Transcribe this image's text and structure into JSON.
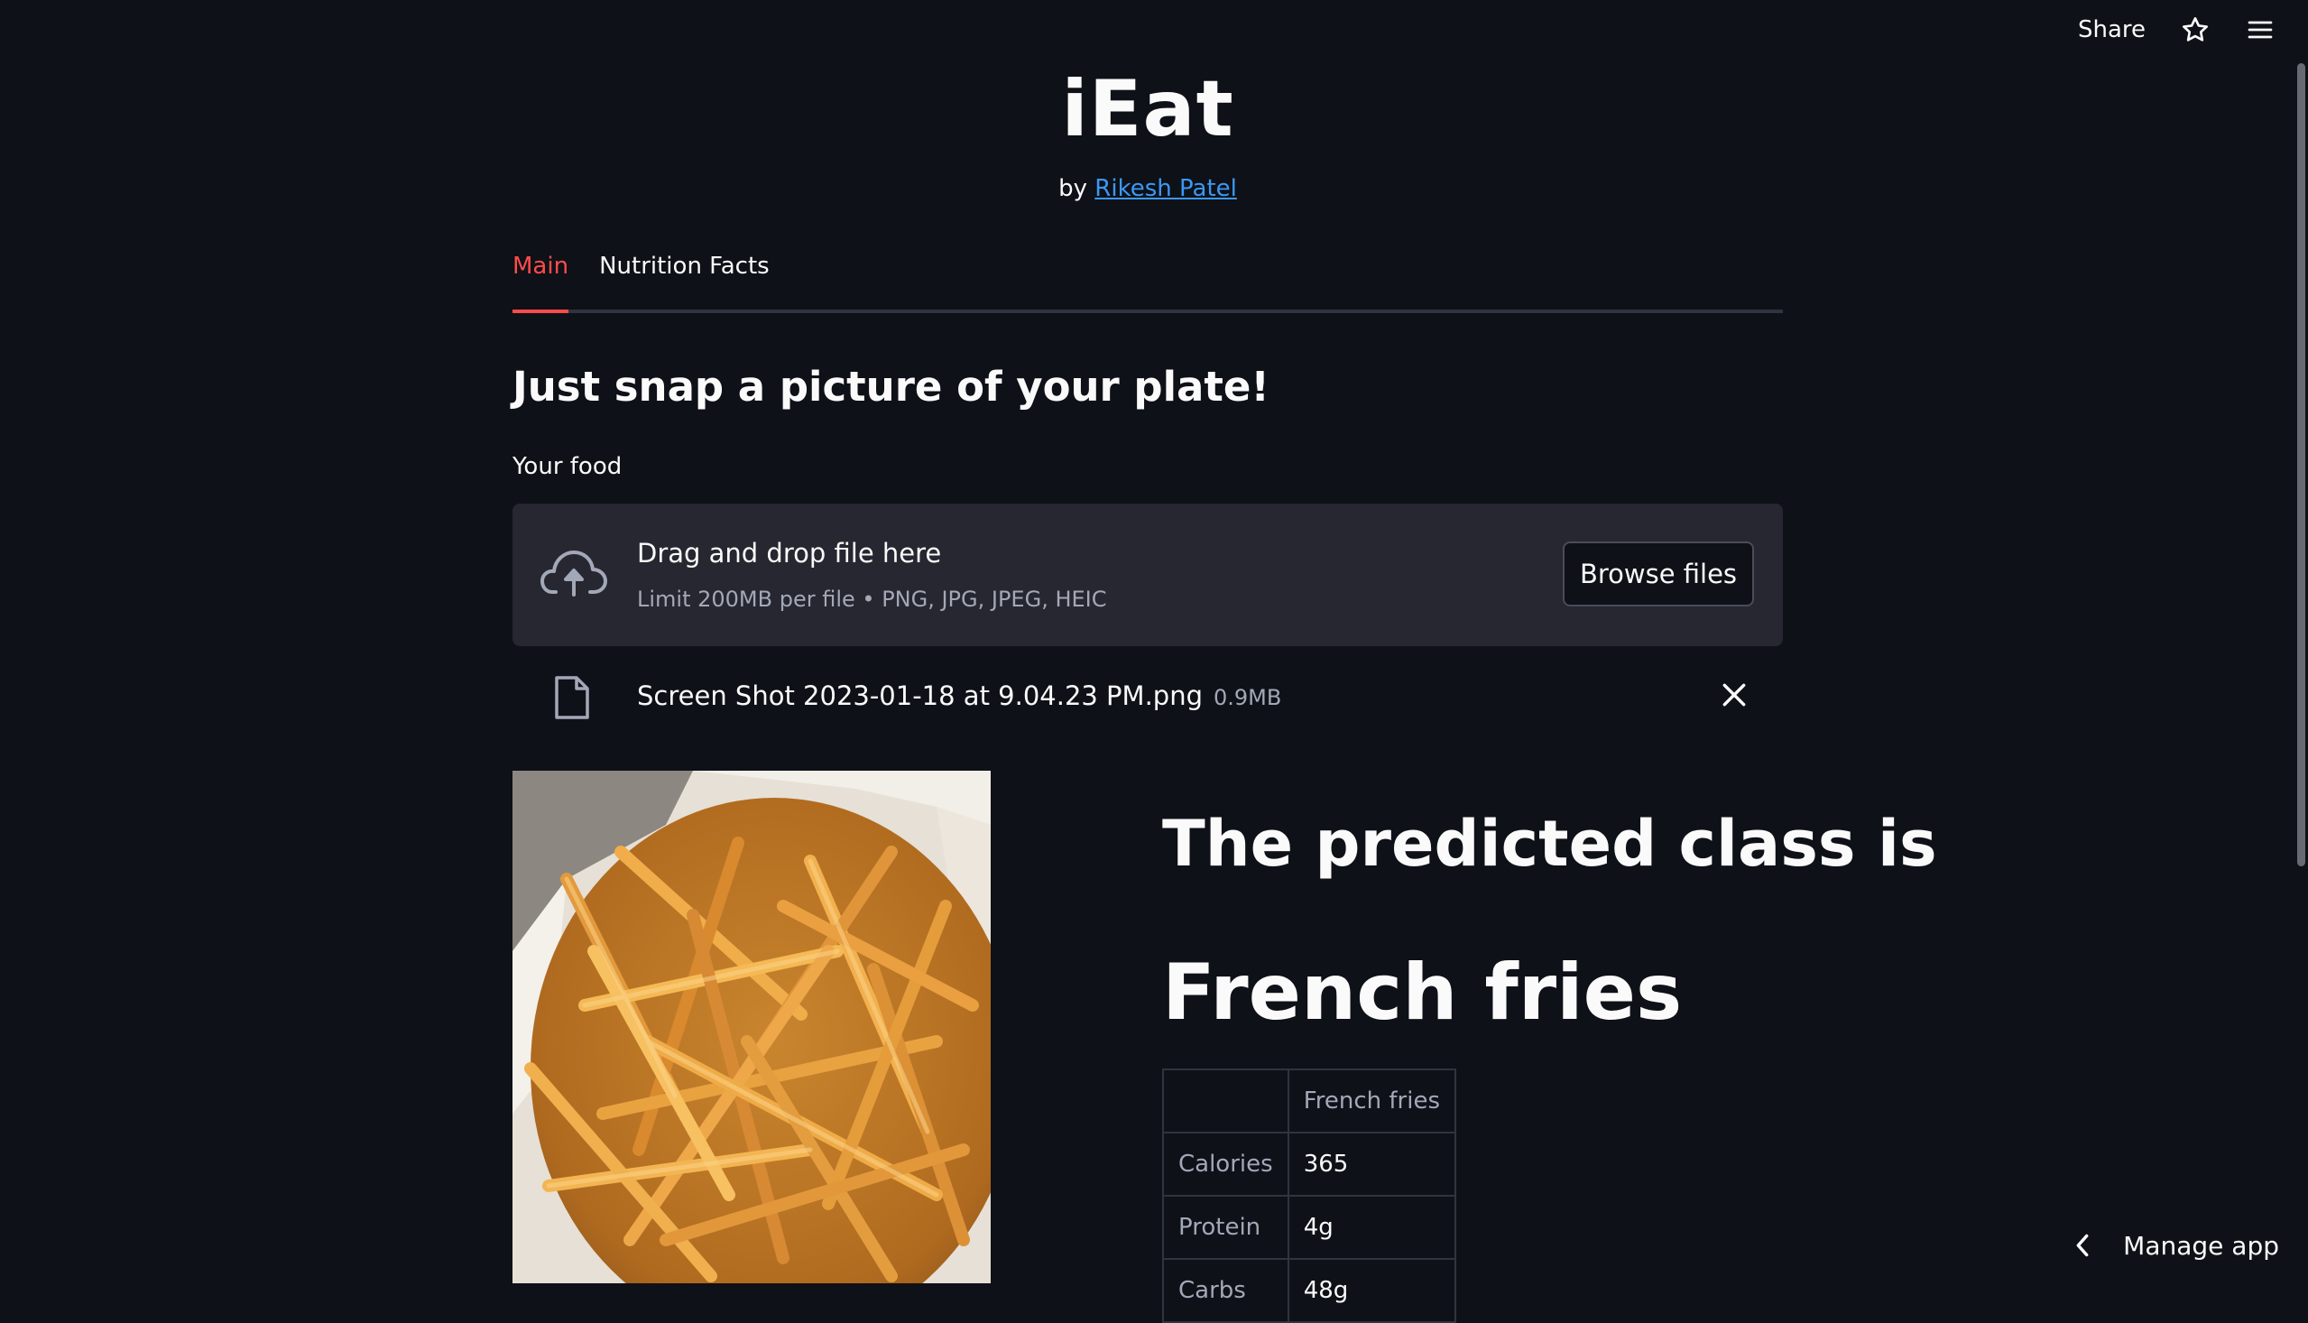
{
  "toolbar": {
    "share_label": "Share",
    "star_icon": "star-icon",
    "menu_icon": "hamburger-menu-icon"
  },
  "header": {
    "title": "iEat",
    "by_prefix": "by",
    "author": "Rikesh Patel"
  },
  "tabs": [
    {
      "label": "Main",
      "active": true
    },
    {
      "label": "Nutrition Facts",
      "active": false
    }
  ],
  "main": {
    "subheader": "Just snap a picture of your plate!",
    "uploader_label": "Your food",
    "dropzone": {
      "title": "Drag and drop file here",
      "limit": "Limit 200MB per file • PNG, JPG, JPEG, HEIC",
      "browse_label": "Browse files"
    },
    "uploaded_file": {
      "name": "Screen Shot 2023-01-18 at 9.04.23 PM.png",
      "size": "0.9MB"
    },
    "prediction": {
      "label": "The predicted class is",
      "value": "French fries"
    },
    "nutrition_table": {
      "column_header": "French fries",
      "rows": [
        {
          "name": "Calories",
          "value": "365"
        },
        {
          "name": "Protein",
          "value": "4g"
        },
        {
          "name": "Carbs",
          "value": "48g"
        }
      ]
    }
  },
  "footer": {
    "manage_label": "Manage app"
  },
  "colors": {
    "background": "#0e1117",
    "accent": "#ff4b4b",
    "link": "#3b98f5",
    "panel": "#262730"
  }
}
